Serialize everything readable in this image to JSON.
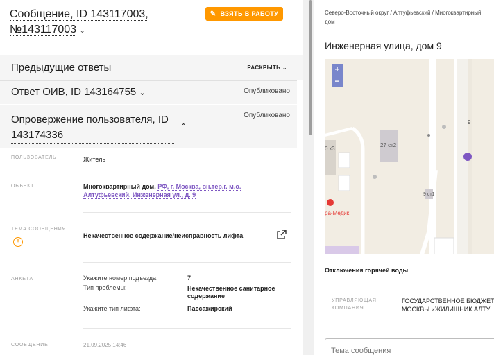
{
  "message": {
    "title_line1": "Сообщение, ID 143117003,",
    "title_line2": "№143117003",
    "take_button": "ВЗЯТЬ В РАБОТУ"
  },
  "previous": {
    "title": "Предыдущие ответы",
    "expand": "РАСКРЫТЬ"
  },
  "answer": {
    "title": "Ответ ОИВ, ID 143164755",
    "status": "Опубликовано"
  },
  "refutation": {
    "title": "Опровержение пользователя, ID 143174336",
    "status": "Опубликовано"
  },
  "details": {
    "user_label": "ПОЛЬЗОВАТЕЛЬ",
    "user_value": "Житель",
    "object_label": "ОБЪЕКТ",
    "object_type": "Многоквартирный дом,",
    "object_link_1": "РФ, г. Москва, вн.тер.г. м.о.",
    "object_link_2": "Алтуфьевский, Инженерная ул., д. 9",
    "topic_label": "ТЕМА СООБЩЕНИЯ",
    "topic_value": "Некачественное содержание/неисправность лифта",
    "survey_label": "АНКЕТА",
    "survey": [
      {
        "q": "Укажите номер подъезда:",
        "a": "7"
      },
      {
        "q": "Тип проблемы:",
        "a": "Некачественное санитарное содержание"
      },
      {
        "q": "Укажите тип лифта:",
        "a": "Пассажирский"
      }
    ],
    "message_label": "СООБЩЕНИЕ",
    "message_date": "21.09.2025 14:46"
  },
  "right": {
    "breadcrumb": "Северо-Восточный округ / Алтуфьевский / Многоквартирный дом",
    "address": "Инженерная улица, дом 9",
    "map": {
      "zoom_in": "+",
      "zoom_out": "−",
      "label_27": "27 ст2",
      "label_9st1": "9 ст1",
      "label_9": "9",
      "label_k3": "0 к3",
      "label_med": "ра-Медик"
    },
    "outage_title": "Отключения горячей воды",
    "uk_label": "УПРАВЛЯЮЩАЯ КОМПАНИЯ",
    "uk_value_1": "ГОСУДАРСТВЕННОЕ БЮДЖЕТ",
    "uk_value_2": "МОСКВЫ «ЖИЛИЩНИК АЛТУ",
    "subject_placeholder": "Тема сообщения"
  },
  "colors": {
    "accent": "#ff9800",
    "link": "#7e57c2",
    "map_marker": "#7e57c2"
  }
}
